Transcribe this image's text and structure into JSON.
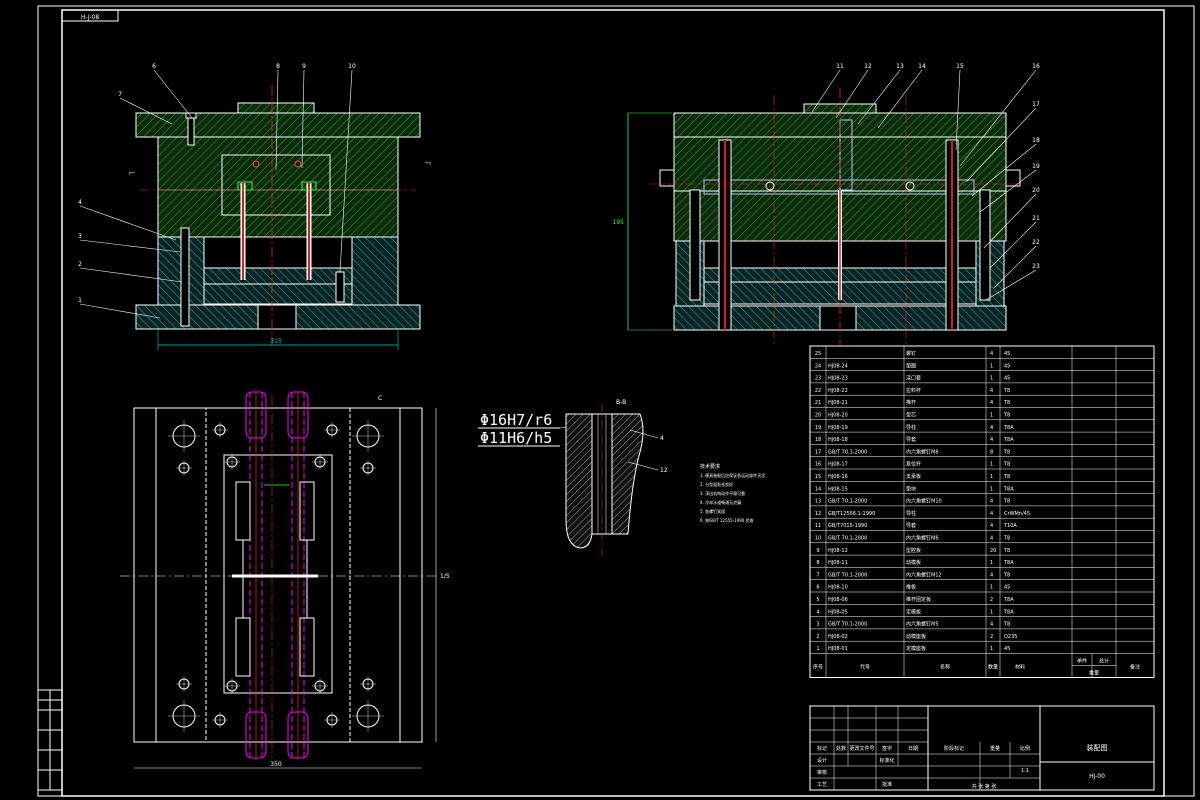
{
  "title_tag": "装配图",
  "fit_notes": {
    "line1": "Φ16H7/r6",
    "line2": "Φ11H6/h5"
  },
  "section_marks": {
    "top": "A-A",
    "detail": "B-B"
  },
  "dims": {
    "front_width": "315",
    "side_height": "195",
    "plan_width": "350",
    "plan_height": "1/5"
  },
  "balloons_front": [
    "6",
    "7",
    "8",
    "9",
    "10",
    "4",
    "3",
    "2",
    "1"
  ],
  "balloons_side": [
    "11",
    "12",
    "13",
    "14",
    "15",
    "16",
    "17",
    "18",
    "19",
    "20",
    "21",
    "22",
    "23"
  ],
  "detail_balloons": [
    "4",
    "12"
  ],
  "tech_notes": [
    "技术要求",
    "1. 模具装配后应保证各运动部件灵活",
    "2. 分型面贴合良好",
    "3. 顶出机构动作平稳可靠",
    "4. 冷却水道畅通无泄漏",
    "5. 各螺钉紧固",
    "6. 按GB/T 12555-1990 验收"
  ],
  "bom": {
    "header": [
      "序号",
      "代号",
      "名称",
      "数量",
      "材料",
      "单件",
      "总计",
      "备注"
    ],
    "header_weight": "重量",
    "rows": [
      [
        "25",
        "",
        "螺钉",
        "4",
        "45"
      ],
      [
        "24",
        "HJ08-24",
        "垫圈",
        "1",
        "45"
      ],
      [
        "23",
        "HJ08-23",
        "浇口套",
        "1",
        "45"
      ],
      [
        "22",
        "HJ08-22",
        "拉料杆",
        "4",
        "T8"
      ],
      [
        "21",
        "HJ08-21",
        "推杆",
        "4",
        "T8"
      ],
      [
        "20",
        "HJ08-20",
        "型芯",
        "1",
        "T8"
      ],
      [
        "19",
        "HJ08-19",
        "导柱",
        "4",
        "T8A"
      ],
      [
        "18",
        "HJ08-18",
        "导套",
        "4",
        "T8A"
      ],
      [
        "17",
        "GB/T 70.1-2000",
        "内六角螺钉M8",
        "8",
        "T8"
      ],
      [
        "16",
        "HJ08-17",
        "复位杆",
        "1",
        "T8"
      ],
      [
        "15",
        "HJ08-16",
        "支承板",
        "1",
        "T8"
      ],
      [
        "14",
        "HJ08-15",
        "垫块",
        "1",
        "T8A"
      ],
      [
        "13",
        "GB/T 70.1-2000",
        "内六角螺钉M10",
        "4",
        "T8"
      ],
      [
        "12",
        "GB/T12556.1-1990",
        "导柱",
        "4",
        "CrWMn/45"
      ],
      [
        "11",
        "GB/T7015-1990",
        "导套",
        "4",
        "T10A"
      ],
      [
        "10",
        "GB/T 70.1-2000",
        "内六角螺钉M6",
        "4",
        "T8"
      ],
      [
        "9",
        "HJ08-12",
        "型腔板",
        "20",
        "T8"
      ],
      [
        "8",
        "HJ08-11",
        "动模板",
        "1",
        "T8A"
      ],
      [
        "7",
        "GB/T 70.1-2000",
        "内六角螺钉M12",
        "4",
        "T8"
      ],
      [
        "6",
        "HJ08-10",
        "推板",
        "1",
        "45"
      ],
      [
        "5",
        "HJ08-06",
        "推杆固定板",
        "2",
        "T8A"
      ],
      [
        "4",
        "HJ08-05",
        "定模板",
        "1",
        "T8A"
      ],
      [
        "3",
        "GB/T 70.1-2000",
        "内六角螺钉M5",
        "4",
        "T8"
      ],
      [
        "2",
        "HJ08-02",
        "动模座板",
        "2",
        "Q235"
      ],
      [
        "1",
        "HJ08-01",
        "定模座板",
        "1",
        "45"
      ]
    ]
  },
  "title_block": {
    "drawing_name": "装配图",
    "drawing_code": "HJ-00",
    "scale_label": "比例",
    "scale": "1:1",
    "stage": "阶段标记",
    "weight": "重量",
    "labels": [
      "标记",
      "处数",
      "更改文件号",
      "签字",
      "日期"
    ],
    "design": "设计",
    "check": "审核",
    "process": "工艺",
    "approve": "批准",
    "sheet": "共 张 第 张",
    "std": "标准化"
  },
  "corner_tag": "H-J-08",
  "side_strip": [
    "借用件登记",
    "旧底图总号",
    "底图总号",
    "签字",
    "日期"
  ],
  "colors": {
    "background": "#000000",
    "frame": "#ffffff",
    "hatch_steel": "#2fa82f",
    "hatch_plate": "#2fa8a8",
    "centerline": "#ff2020",
    "pin": "#ff00ff",
    "dimension": "#00d0d0",
    "cavity": "#c0c0ff"
  }
}
